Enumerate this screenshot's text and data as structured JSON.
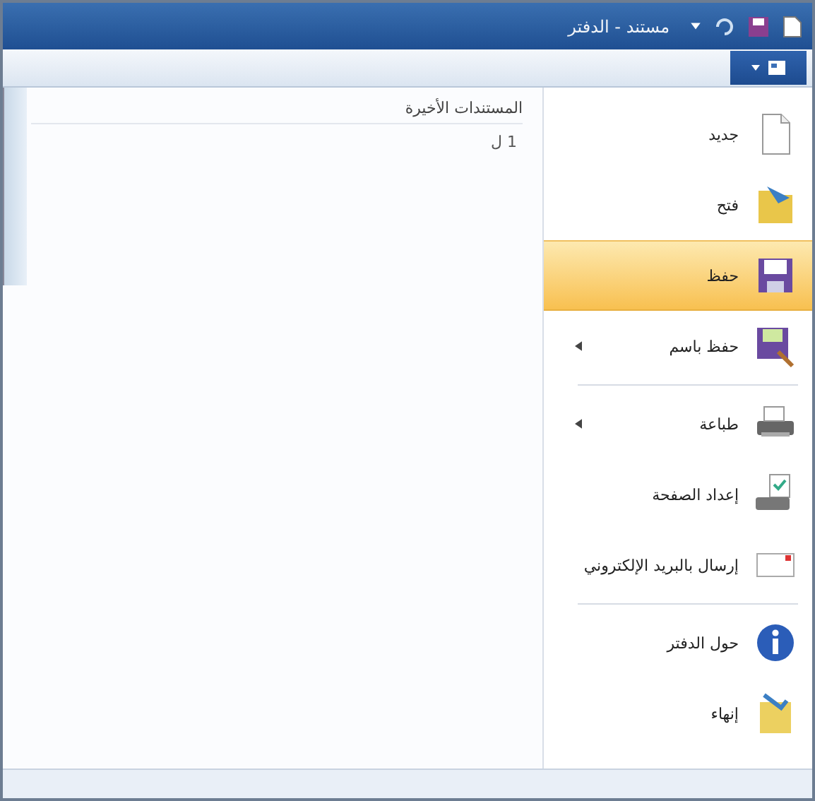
{
  "window": {
    "title": "مستند - الدفتر"
  },
  "menu_items": [
    {
      "label": "جديد",
      "kind": "new",
      "selected": false,
      "submenu": false,
      "separator_after": false
    },
    {
      "label": "فتح",
      "kind": "open",
      "selected": false,
      "submenu": false,
      "separator_after": false
    },
    {
      "label": "حفظ",
      "kind": "save",
      "selected": true,
      "submenu": false,
      "separator_after": false
    },
    {
      "label": "حفظ باسم",
      "kind": "saveas",
      "selected": false,
      "submenu": true,
      "separator_after": true
    },
    {
      "label": "طباعة",
      "kind": "print",
      "selected": false,
      "submenu": true,
      "separator_after": false
    },
    {
      "label": "إعداد الصفحة",
      "kind": "pagesetup",
      "selected": false,
      "submenu": false,
      "separator_after": false
    },
    {
      "label": "إرسال بالبريد الإلكتروني",
      "kind": "mail",
      "selected": false,
      "submenu": false,
      "separator_after": true
    },
    {
      "label": "حول الدفتر",
      "kind": "info",
      "selected": false,
      "submenu": false,
      "separator_after": false
    },
    {
      "label": "إنهاء",
      "kind": "exit",
      "selected": false,
      "submenu": false,
      "separator_after": false
    }
  ],
  "recent": {
    "heading": "المستندات الأخيرة",
    "items": [
      "1 ل"
    ]
  }
}
